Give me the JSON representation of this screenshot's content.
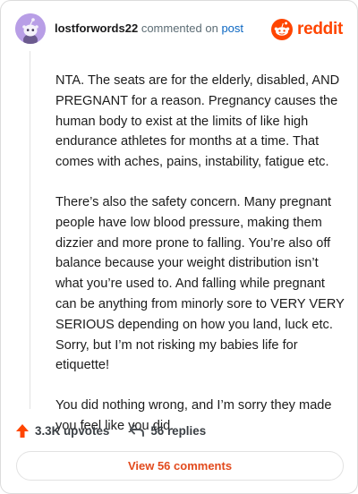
{
  "header": {
    "username": "lostforwords22",
    "commented_text": "commented on",
    "post_link": "post",
    "brand_name": "reddit",
    "avatar_icon": "snoo-avatar-icon",
    "brand_icon": "reddit-logo-icon"
  },
  "comment": {
    "paragraphs": [
      "NTA. The seats are for the elderly, disabled, AND PREGNANT for a reason. Pregnancy causes the human body to exist at the limits of like high endurance athletes for months at a time. That comes with aches, pains, instability, fatigue etc.",
      "There’s also the safety concern. Many pregnant people have low blood pressure, making them dizzier and more prone to falling. You’re also off balance because your weight distribution isn’t what you’re used to. And falling while pregnant can be anything from minorly sore to VERY VERY SERIOUS depending on how you land, luck etc. Sorry, but I’m not risking my babies life for etiquette!",
      "You did nothing wrong, and I’m sorry they made you feel like you did."
    ]
  },
  "actions": {
    "upvotes_label": "3.3K upvotes",
    "replies_label": "56 replies",
    "upvote_icon": "upvote-arrow-icon",
    "reply_icon": "reply-arrow-icon"
  },
  "footer": {
    "view_comments_label": "View 56 comments"
  },
  "colors": {
    "brand": "#ff4500",
    "link": "#0a66c2",
    "avatar_bg": "#b89ee6",
    "button_text": "#e24a1d"
  }
}
